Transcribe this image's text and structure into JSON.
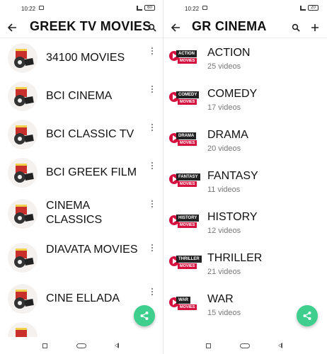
{
  "left_screen": {
    "status": {
      "time": "10:22",
      "battery": "60"
    },
    "title": "GREEK TV MOVIES",
    "channels": [
      {
        "name": "34100 MOVIES"
      },
      {
        "name": "BCI CINEMA"
      },
      {
        "name": "BCI CLASSIC TV"
      },
      {
        "name": "BCI GREEK FILM"
      },
      {
        "name": "CINEMA CLASSICS"
      },
      {
        "name": "DIAVATA MOVIES"
      },
      {
        "name": "CINE ELLADA"
      }
    ]
  },
  "right_screen": {
    "status": {
      "time": "10:22",
      "battery": "20"
    },
    "title": "GR CINEMA",
    "badge_suffix": "MOVIES",
    "genres": [
      {
        "name": "ACTION",
        "badge": "ACTION",
        "count": "25 videos"
      },
      {
        "name": "COMEDY",
        "badge": "COMEDY",
        "count": "17 videos"
      },
      {
        "name": "DRAMA",
        "badge": "DRAMA",
        "count": "20 videos"
      },
      {
        "name": "FANTASY",
        "badge": "FANTASY",
        "count": "11 videos"
      },
      {
        "name": "HISTORY",
        "badge": "HISTORY",
        "count": "12 videos"
      },
      {
        "name": "THRILLER",
        "badge": "THRILLER",
        "count": "21 videos"
      },
      {
        "name": "WAR",
        "badge": "WAR",
        "count": "15 videos"
      }
    ]
  },
  "colors": {
    "fab": "#3ecf8e",
    "badge_red": "#d4113f",
    "badge_dark": "#222222"
  },
  "icons": [
    "back-arrow-icon",
    "search-icon",
    "add-icon",
    "share-icon",
    "more-vert-icon",
    "play-icon"
  ]
}
